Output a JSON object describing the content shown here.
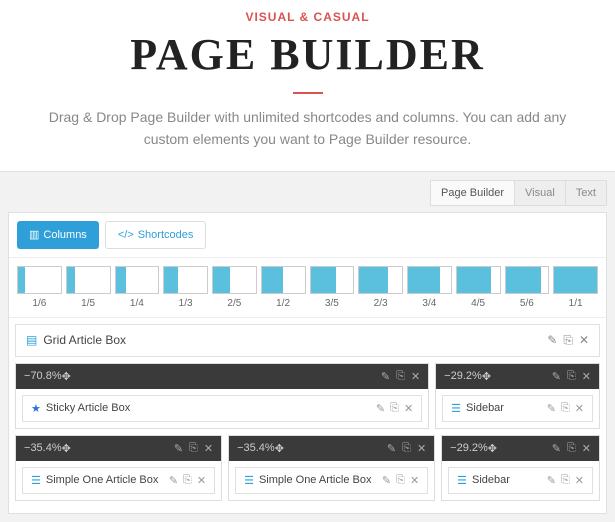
{
  "hero": {
    "kicker": "VISUAL & CASUAL",
    "title": "PAGE BUILDER",
    "subtitle": "Drag & Drop Page Builder with unlimited shortcodes and columns. You can add any custom elements you want to Page Builder resource."
  },
  "tabs": {
    "builder": "Page Builder",
    "visual": "Visual",
    "text": "Text"
  },
  "toolbar": {
    "columns": "Columns",
    "shortcodes": "Shortcodes"
  },
  "columns": {
    "c1": "1/6",
    "c2": "1/5",
    "c3": "1/4",
    "c4": "1/3",
    "c5": "2/5",
    "c6": "1/2",
    "c7": "3/5",
    "c8": "2/3",
    "c9": "3/4",
    "c10": "4/5",
    "c11": "5/6",
    "c12": "1/1"
  },
  "widgets": {
    "grid": "Grid Article Box",
    "sticky": "Sticky Article Box",
    "sidebar": "Sidebar",
    "simple": "Simple One Article Box"
  },
  "rows": {
    "r1a": "70.8%",
    "r1b": "29.2%",
    "r2a": "35.4%",
    "r2b": "35.4%",
    "r2c": "29.2%"
  },
  "icons": {
    "minus": "−",
    "move": "✥",
    "edit": "✎",
    "copy": "⎘",
    "close": "✕",
    "grid": "▤",
    "star": "★",
    "list": "☰",
    "code": "</>",
    "cols": "▥"
  }
}
